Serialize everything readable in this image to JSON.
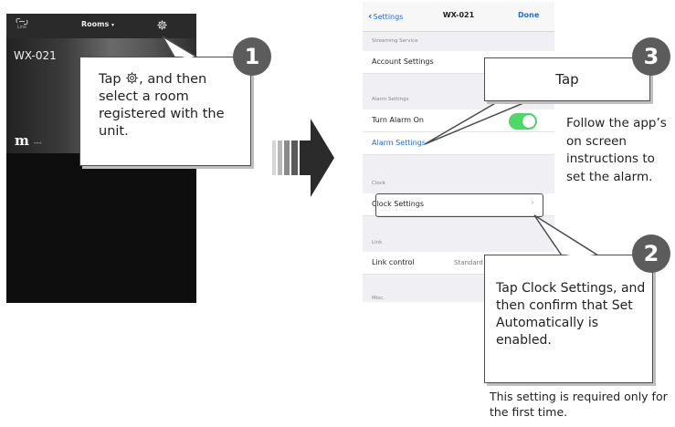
{
  "phone1": {
    "link_label": "Link",
    "rooms_label": "Rooms",
    "room_name": "WX-021",
    "room_badge": "m",
    "room_dash": "---"
  },
  "phone2": {
    "back_label": "Settings",
    "title": "WX-021",
    "done_label": "Done",
    "sections": {
      "streaming": "Streaming Service",
      "alarm": "Alarm Settings",
      "clock": "Clock",
      "link": "Link",
      "misc": "Misc."
    },
    "rows": {
      "account_settings": "Account Settings",
      "turn_alarm_on": "Turn Alarm On",
      "alarm_settings": "Alarm Settings",
      "clock_settings": "Clock Settings",
      "link_control": "Link control",
      "link_control_value": "Standard"
    },
    "alarm_toggle": "on"
  },
  "callout1": {
    "number": "1",
    "text_before": "Tap ",
    "text_after": ", and then select a room registered with the unit."
  },
  "callout2": {
    "number": "2",
    "text": "Tap Clock Settings, and then confirm that Set Automatically is enabled."
  },
  "callout3": {
    "number": "3",
    "text": "Tap"
  },
  "side_note": "Follow the app’s on screen instructions to set the alarm.",
  "foot_note": "This setting is required only for the first time.",
  "colors": {
    "accent_blue": "#1f6fd6",
    "toggle_green": "#4cd964",
    "badge_gray": "#5c5c5c"
  },
  "icons": [
    "link-icon",
    "gear-icon",
    "chevron-down-icon",
    "chevron-left-icon",
    "chevron-right-icon",
    "arrow-right-icon"
  ]
}
